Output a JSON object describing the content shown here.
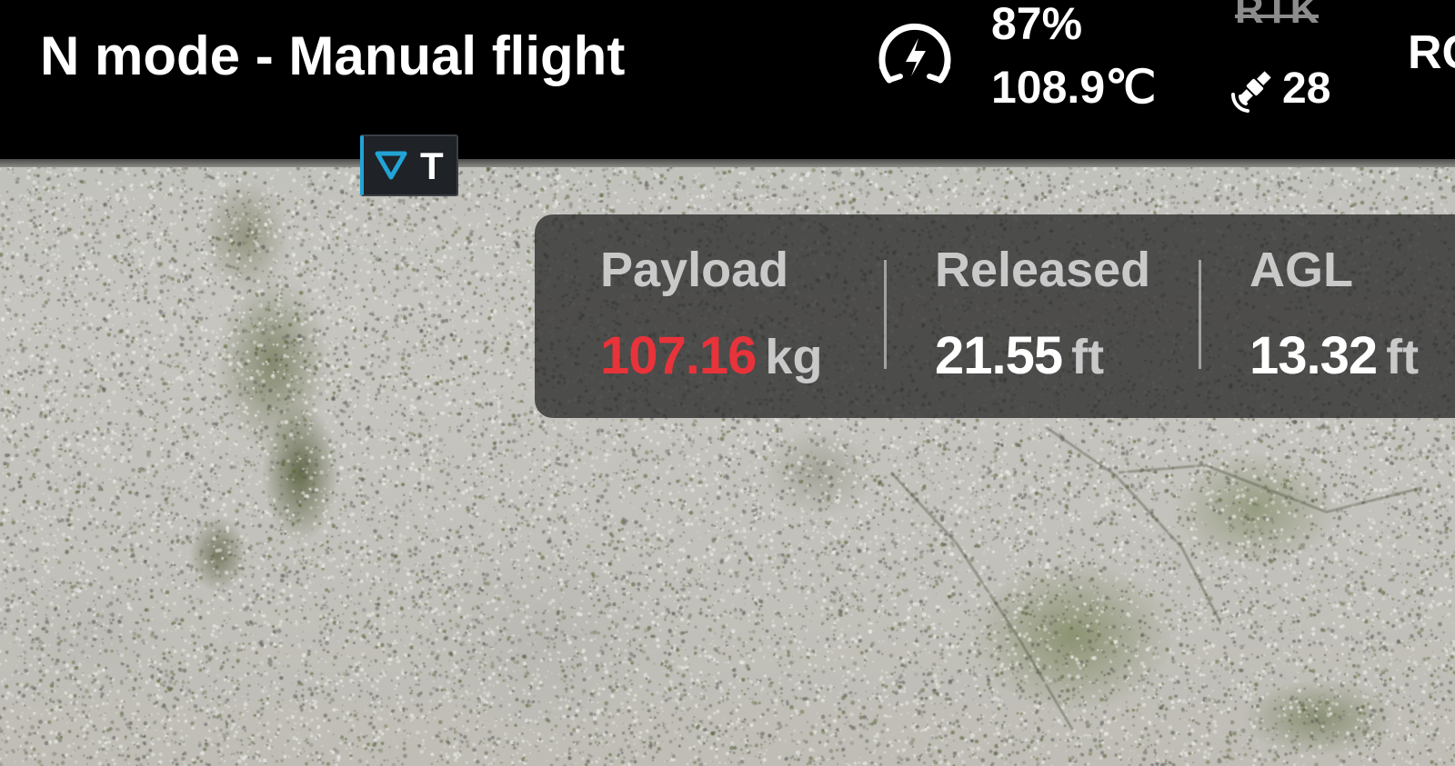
{
  "status_bar": {
    "flight_mode": "N mode - Manual flight",
    "battery": {
      "icon": "battery-gauge-icon",
      "percent": "87%",
      "temperature": "108.9℃"
    },
    "rtk": {
      "label": "RTK",
      "state": "inactive"
    },
    "satellites": {
      "icon": "satellite-icon",
      "count": "28"
    },
    "rc_label": "RC"
  },
  "target_marker": {
    "icon": "triangle-down-icon",
    "label": "T",
    "accent_color": "#22a3d6"
  },
  "telemetry": [
    {
      "label": "Payload",
      "value": "107.16",
      "unit": "kg",
      "alert": true
    },
    {
      "label": "Released",
      "value": "21.55",
      "unit": "ft",
      "alert": false
    },
    {
      "label": "AGL",
      "value": "13.32",
      "unit": "ft",
      "alert": false
    }
  ],
  "colors": {
    "alert": "#e8333a",
    "panel_text": "#c9c9c9",
    "accent": "#22a3d6"
  }
}
